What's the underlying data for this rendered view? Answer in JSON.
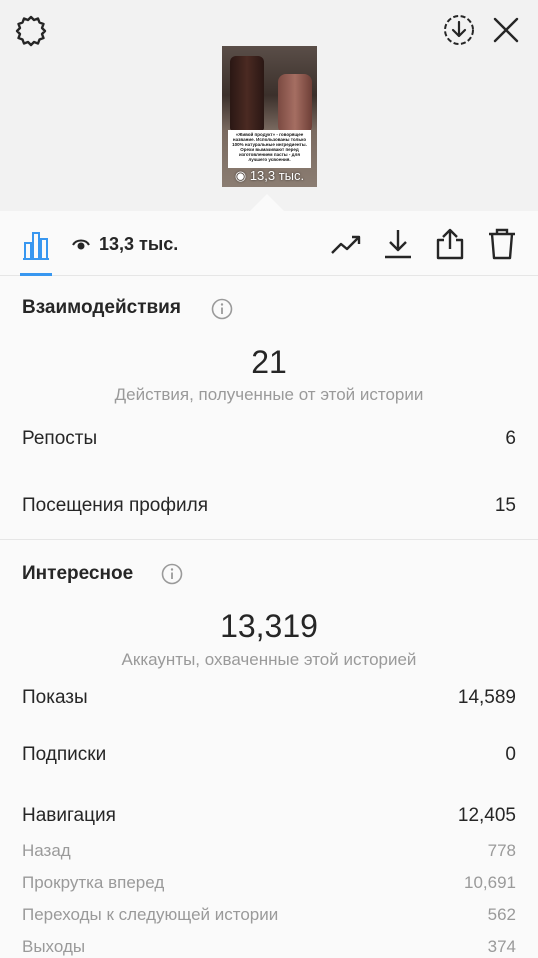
{
  "story": {
    "thumb_caption": "«Живой продукт» - говорящее название. Использованы только 100% натуральные ингредиенты. Орехи вымачивают перед изготовлением пасты - для лучшего усвоения.",
    "thumb_views": "13,3 тыс."
  },
  "toolbar": {
    "views": "13,3 тыс."
  },
  "interactions": {
    "title": "Взаимодействия",
    "total": "21",
    "subtitle": "Действия, полученные от этой истории",
    "rows": [
      {
        "label": "Репосты",
        "value": "6"
      },
      {
        "label": "Посещения профиля",
        "value": "15"
      }
    ]
  },
  "discovery": {
    "title": "Интересное",
    "total": "13,319",
    "subtitle": "Аккаунты, охваченные этой историей",
    "rows": [
      {
        "label": "Показы",
        "value": "14,589"
      },
      {
        "label": "Подписки",
        "value": "0"
      },
      {
        "label": "Навигация",
        "value": "12,405"
      }
    ],
    "nav_rows": [
      {
        "label": "Назад",
        "value": "778"
      },
      {
        "label": "Прокрутка вперед",
        "value": "10,691"
      },
      {
        "label": "Переходы к следующей истории",
        "value": "562"
      },
      {
        "label": "Выходы",
        "value": "374"
      }
    ]
  },
  "colors": {
    "accent": "#3897f0",
    "text": "#262626",
    "muted": "#9a9a9a"
  },
  "icons": [
    "gear-icon",
    "download-circle-icon",
    "close-icon",
    "bar-chart-icon",
    "eye-icon",
    "trend-icon",
    "download-icon",
    "share-icon",
    "trash-icon",
    "info-icon"
  ]
}
